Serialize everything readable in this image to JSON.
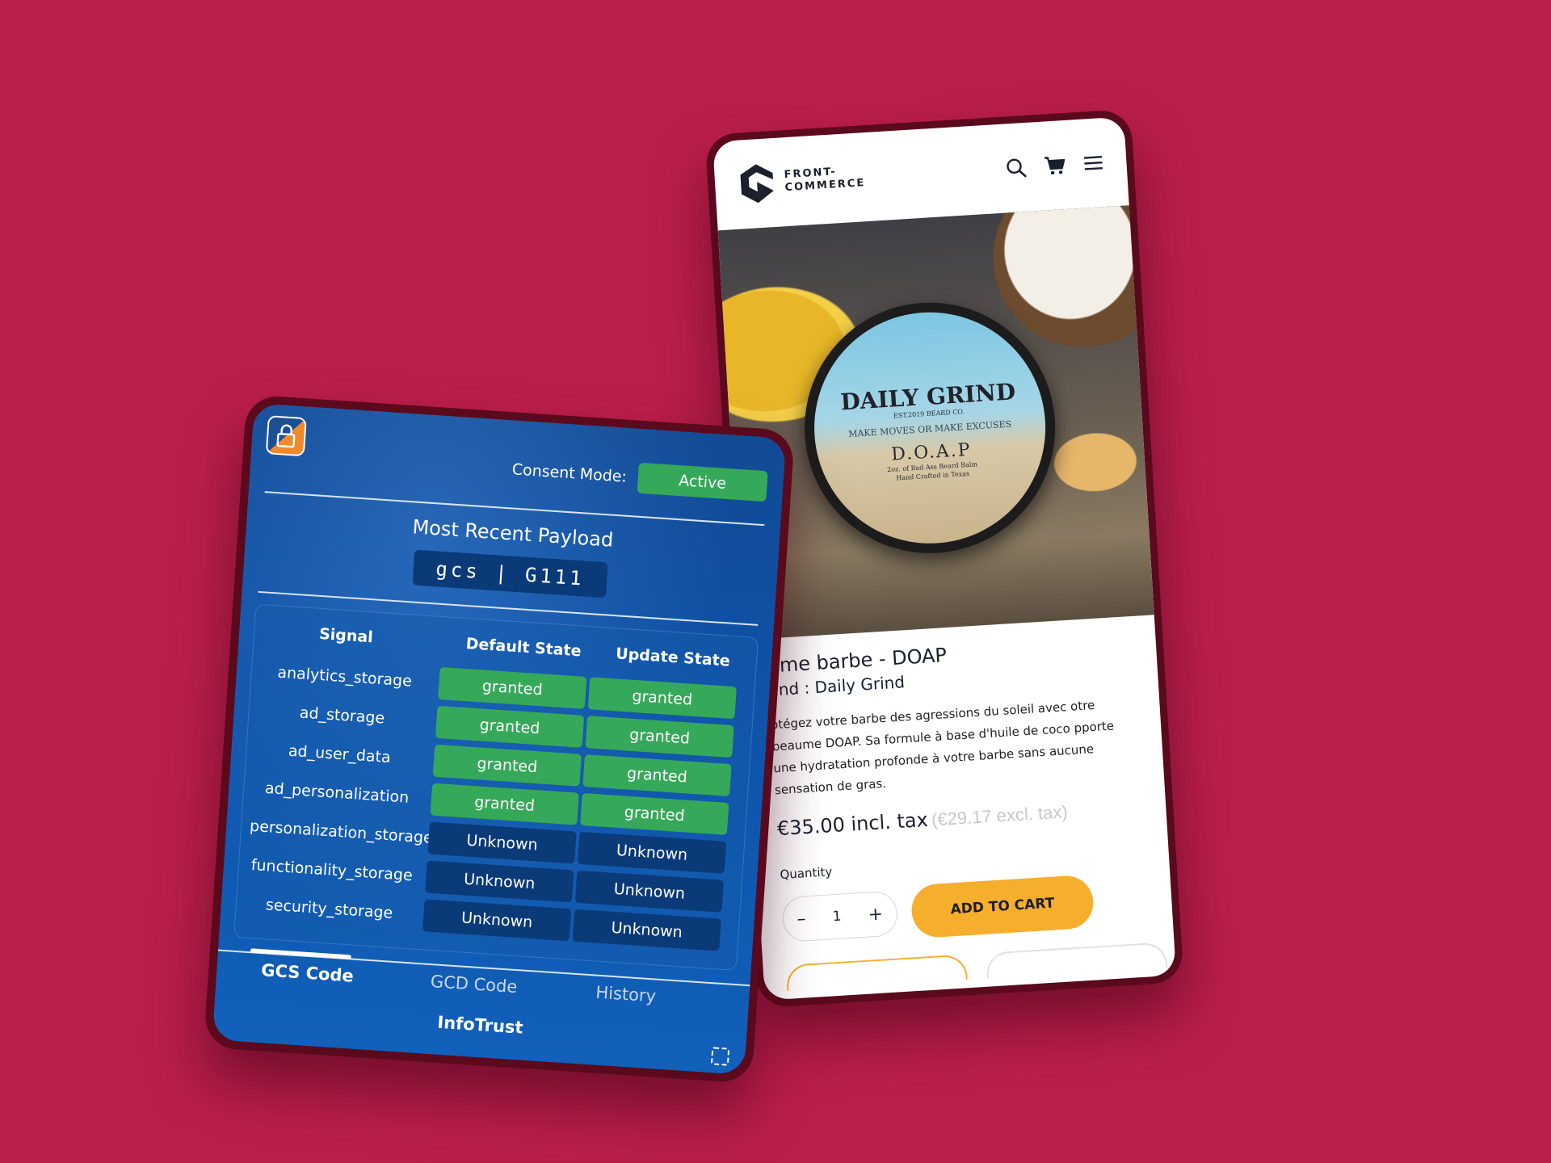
{
  "colors": {
    "background": "#bb1e4b",
    "accent_orange": "#f6ae2d",
    "granted_green": "#36a85a",
    "unknown_navy": "#0b3a78"
  },
  "storefront": {
    "logo": {
      "line1": "FRONT-",
      "line2": "COMMERCE"
    },
    "header_icons": [
      "search-icon",
      "cart-icon",
      "menu-icon"
    ],
    "product": {
      "tin": {
        "brand": "DAILY GRIND",
        "est": "EST.2019 BEARD CO.",
        "motto": "MAKE MOVES OR MAKE EXCUSES",
        "name": "D.O.A.P",
        "sub1": "2oz. of Bad Ass Beard Balm",
        "sub2": "Hand Crafted in Texas"
      },
      "title": "ume barbe - DOAP",
      "brand": "and : Daily Grind",
      "description": "otégez votre barbe des agressions du soleil avec otre beaume DOAP. Sa formule à base d'huile de coco pporte une hydratation profonde à votre barbe sans aucune sensation de gras.",
      "price": "€35.00 incl. tax",
      "price_excl": "(€29.17 excl. tax)",
      "quantity_label": "Quantity",
      "quantity": "1",
      "minus": "–",
      "plus": "+",
      "add_to_cart": "ADD TO CART"
    }
  },
  "consent_app": {
    "consent_label": "Consent Mode:",
    "consent_status": "Active",
    "payload_title": "Most Recent Payload",
    "payload_code": "gcs | G111",
    "headers": {
      "signal": "Signal",
      "default": "Default State",
      "update": "Update State"
    },
    "signals": [
      {
        "name": "analytics_storage",
        "default": "granted",
        "update": "granted"
      },
      {
        "name": "ad_storage",
        "default": "granted",
        "update": "granted"
      },
      {
        "name": "ad_user_data",
        "default": "granted",
        "update": "granted"
      },
      {
        "name": "ad_personalization",
        "default": "granted",
        "update": "granted"
      },
      {
        "name": "personalization_storage",
        "default": "Unknown",
        "update": "Unknown"
      },
      {
        "name": "functionality_storage",
        "default": "Unknown",
        "update": "Unknown"
      },
      {
        "name": "security_storage",
        "default": "Unknown",
        "update": "Unknown"
      }
    ],
    "tabs": [
      "GCS Code",
      "GCD Code",
      "History"
    ],
    "active_tab": "GCS Code",
    "footer_brand": "InfoTrust"
  }
}
